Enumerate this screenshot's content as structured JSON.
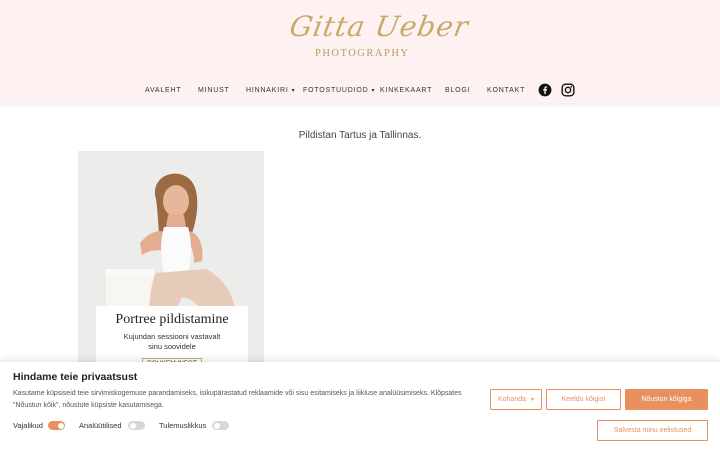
{
  "brand": {
    "logo_script": "Gitta Ueber",
    "logo_sub": "PHOTOGRAPHY",
    "gold": "#c9a96a"
  },
  "nav": {
    "items": [
      "AVALEHT",
      "MINUST",
      "HINNAKIRI",
      "FOTOSTUUDIOD",
      "KINKEKAART",
      "BLOGI",
      "KONTAKT"
    ],
    "dropdown_caret": "▾",
    "social": [
      "facebook-icon",
      "instagram-icon"
    ]
  },
  "main": {
    "tagline": "Pildistan Tartus ja Tallinnas.",
    "card": {
      "title": "Portree pildistamine",
      "desc_line1": "Kujundan sessiooni vastavalt",
      "desc_line2": "sinu soovidele",
      "more": "ROHKEM INFOT"
    }
  },
  "cookie": {
    "title": "Hindame teie privaatsust",
    "text": "Kasutame küpsiseid teie sirvimiskogemuse parandamiseks, isikupärastatud reklaamide või sisu esitamiseks ja liikluse analüüsimiseks. Klõpsates \"Nõustun kõik\", nõustute küpsiste kasutamisega.",
    "toggles": [
      {
        "label": "Vajalikud",
        "on": true
      },
      {
        "label": "Analüütilised",
        "on": false
      },
      {
        "label": "Tulemuslikkus",
        "on": false
      }
    ],
    "customize": "Kohanda",
    "reject": "Keeldu kõigist",
    "accept": "Nõustun kõigiga",
    "save": "Salvesta minu eelistused",
    "accent": "#e8915f"
  },
  "colors": {
    "header_bg": "#fdf2f1",
    "accent": "#e8915f"
  }
}
